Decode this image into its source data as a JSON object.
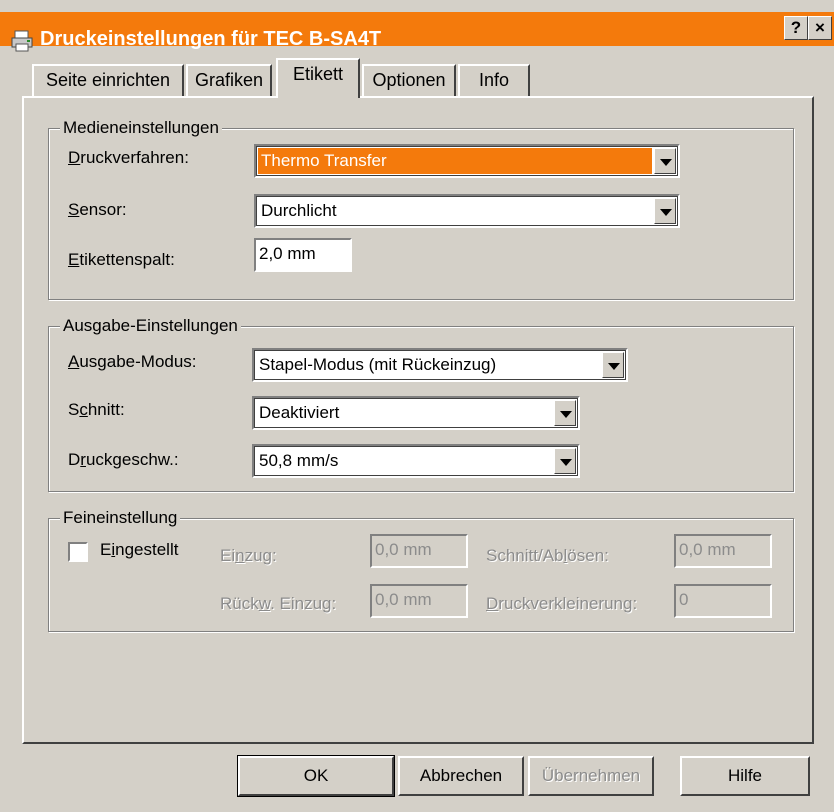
{
  "window": {
    "title": "Druckeinstellungen für TEC B-SA4T",
    "help_button": "?",
    "close_button": "×"
  },
  "tabs": [
    {
      "label": "Seite einrichten",
      "active": false
    },
    {
      "label": "Grafiken",
      "active": false
    },
    {
      "label": "Etikett",
      "active": true
    },
    {
      "label": "Optionen",
      "active": false
    },
    {
      "label": "Info",
      "active": false
    }
  ],
  "media": {
    "group_title": "Medieneinstellungen",
    "druckverfahren": {
      "label": "Druckverfahren:",
      "value": "Thermo Transfer"
    },
    "sensor": {
      "label": "Sensor:",
      "value": "Durchlicht"
    },
    "etikettenspalt": {
      "label": "Etikettenspalt:",
      "value": "2,0 mm"
    }
  },
  "output": {
    "group_title": "Ausgabe-Einstellungen",
    "ausgabe_modus": {
      "label": "Ausgabe-Modus:",
      "value": "Stapel-Modus (mit Rückeinzug)"
    },
    "schnitt": {
      "label": "Schnitt:",
      "value": "Deaktiviert"
    },
    "druckgeschw": {
      "label": "Druckgeschw.:",
      "value": "50,8 mm/s"
    }
  },
  "fine": {
    "group_title": "Feineinstellung",
    "eingestellt": {
      "label": "Eingestellt",
      "checked": false
    },
    "einzug": {
      "label": "Einzug:",
      "value": "0,0 mm"
    },
    "schnitt_abloesen": {
      "label": "Schnitt/Ablösen:",
      "value": "0,0 mm"
    },
    "rueckw_einzug": {
      "label": "Rückw. Einzug:",
      "value": "0,0 mm"
    },
    "druckverkleinerung": {
      "label": "Druckverkleinerung:",
      "value": "0"
    }
  },
  "buttons": {
    "ok": "OK",
    "abbrechen": "Abbrechen",
    "uebernehmen": "Übernehmen",
    "hilfe": "Hilfe"
  },
  "colors": {
    "titlebar": "#f47a0c",
    "selection": "#f47a0c",
    "face": "#d4d0c8"
  }
}
